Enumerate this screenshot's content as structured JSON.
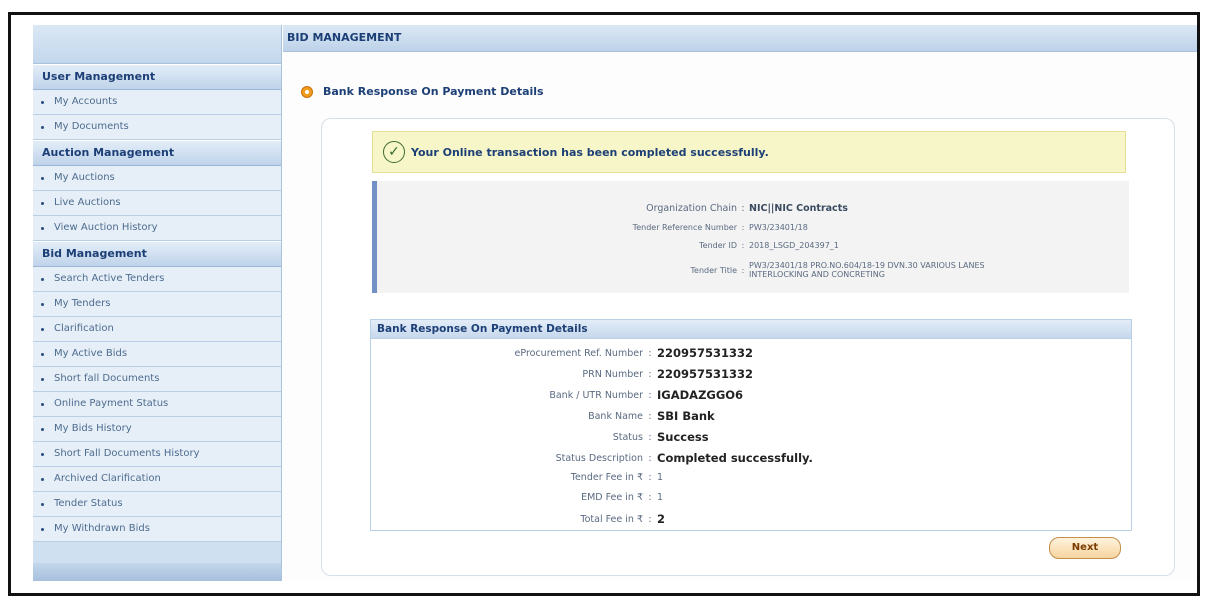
{
  "page": {
    "title": "BID MANAGEMENT",
    "section_title": "Bank Response On Payment Details"
  },
  "sidebar": {
    "groups": [
      {
        "header": "User Management",
        "items": [
          "My Accounts",
          "My Documents"
        ]
      },
      {
        "header": "Auction Management",
        "items": [
          "My Auctions",
          "Live Auctions",
          "View Auction History"
        ]
      },
      {
        "header": "Bid Management",
        "items": [
          "Search Active Tenders",
          "My Tenders",
          "Clarification",
          "My Active Bids",
          "Short fall Documents",
          "Online Payment Status",
          "My Bids History",
          "Short Fall Documents History",
          "Archived Clarification",
          "Tender Status",
          "My Withdrawn Bids"
        ]
      }
    ]
  },
  "success_message": "Your Online transaction has been completed successfully.",
  "tender": {
    "organization_chain_label": "Organization Chain",
    "organization_chain": "NIC||NIC Contracts",
    "reference_label": "Tender Reference Number",
    "reference": "PW3/23401/18",
    "id_label": "Tender ID",
    "id": "2018_LSGD_204397_1",
    "title_label": "Tender Title",
    "title_line1": "PW3/23401/18 PRO.NO.604/18-19 DVN.30 VARIOUS LANES",
    "title_line2": "INTERLOCKING AND CONCRETING"
  },
  "payment": {
    "box_title": "Bank Response On Payment Details",
    "rows": [
      {
        "label": "eProcurement Ref. Number",
        "value": "220957531332"
      },
      {
        "label": "PRN Number",
        "value": "220957531332"
      },
      {
        "label": "Bank / UTR Number",
        "value": "IGADAZGGO6"
      },
      {
        "label": "Bank Name",
        "value": "SBI Bank"
      },
      {
        "label": "Status",
        "value": "Success"
      },
      {
        "label": "Status Description",
        "value": "Completed successfully."
      },
      {
        "label": "Tender Fee in ₹",
        "value": "1"
      },
      {
        "label": "EMD Fee in ₹",
        "value": "1"
      },
      {
        "label": "Total Fee in ₹",
        "value": "2"
      }
    ],
    "sep": ":"
  },
  "buttons": {
    "next": "Next"
  },
  "colors": {
    "accent": "#1c3f76",
    "orange": "#f19a1e",
    "success_bg": "#f7f6c8"
  },
  "icons": {
    "section": "orange-dot-icon",
    "success": "check-circle-icon",
    "bullet": "bullet-icon"
  }
}
